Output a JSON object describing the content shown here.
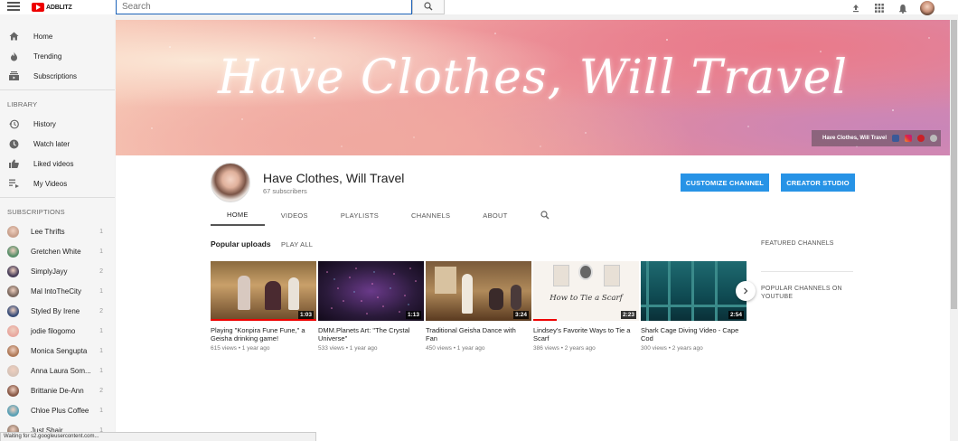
{
  "topbar": {
    "logo_text": "ADBLITZ",
    "search_placeholder": "Search"
  },
  "sidebar": {
    "main_items": [
      {
        "label": "Home",
        "icon": "home-icon"
      },
      {
        "label": "Trending",
        "icon": "flame-icon"
      },
      {
        "label": "Subscriptions",
        "icon": "subscriptions-icon"
      }
    ],
    "library_header": "LIBRARY",
    "library_items": [
      {
        "label": "History",
        "icon": "history-icon"
      },
      {
        "label": "Watch later",
        "icon": "clock-icon"
      },
      {
        "label": "Liked videos",
        "icon": "thumbs-up-icon"
      },
      {
        "label": "My Videos",
        "icon": "playlist-icon"
      }
    ],
    "subscriptions_header": "SUBSCRIPTIONS",
    "subscriptions": [
      {
        "name": "Lee Thrifts",
        "count": "1",
        "color": "#c9a18d"
      },
      {
        "name": "Gretchen White",
        "count": "1",
        "color": "#5a8f6a"
      },
      {
        "name": "SimplyJayy",
        "count": "2",
        "color": "#4a3f5a"
      },
      {
        "name": "Mal IntoTheCity",
        "count": "1",
        "color": "#7d6a60"
      },
      {
        "name": "Styled By Irene",
        "count": "2",
        "color": "#3b4f7a"
      },
      {
        "name": "jodie filogomo",
        "count": "1",
        "color": "#e8a9a0"
      },
      {
        "name": "Monica Sengupta",
        "count": "1",
        "color": "#b07b5a"
      },
      {
        "name": "Anna Laura Som...",
        "count": "1",
        "color": "#d8c4b8"
      },
      {
        "name": "Brittanie De-Ann",
        "count": "2",
        "color": "#8a5a48"
      },
      {
        "name": "Chloe Plus Coffee",
        "count": "1",
        "color": "#5aa0b5"
      },
      {
        "name": "Just Shair",
        "count": "1",
        "color": "#9a8070"
      }
    ]
  },
  "banner": {
    "title": "Have Clothes, Will Travel",
    "link_label": "Have Clothes, Will Travel"
  },
  "channel": {
    "name": "Have Clothes, Will Travel",
    "subscribers": "67 subscribers",
    "customize_label": "CUSTOMIZE CHANNEL",
    "studio_label": "CREATOR STUDIO",
    "tabs": [
      "HOME",
      "VIDEOS",
      "PLAYLISTS",
      "CHANNELS",
      "ABOUT"
    ]
  },
  "uploads": {
    "title": "Popular uploads",
    "play_all": "PLAY ALL",
    "videos": [
      {
        "title": "Playing \"Konpira Fune Fune,\" a Geisha drinking game!",
        "meta": "615 views • 1 year ago",
        "duration": "1:03",
        "progress": 1.0
      },
      {
        "title": "DMM.Planets Art: \"The Crystal Universe\"",
        "meta": "533 views • 1 year ago",
        "duration": "1:13",
        "progress": 0.0
      },
      {
        "title": "Traditional Geisha Dance with Fan",
        "meta": "450 views • 1 year ago",
        "duration": "3:24",
        "progress": 0.0
      },
      {
        "title": "Lindsey's Favorite Ways to Tie a Scarf",
        "meta": "386 views • 2 years ago",
        "duration": "2:23",
        "progress": 0.22
      },
      {
        "title": "Shark Cage Diving Video - Cape Cod",
        "meta": "300 views • 2 years ago",
        "duration": "2:54",
        "progress": 0.0
      }
    ],
    "scarf_thumb_text": "How to Tie a Scarf"
  },
  "right_panel": {
    "featured": "FEATURED CHANNELS",
    "popular": "POPULAR CHANNELS ON YOUTUBE"
  },
  "status_bar": "Waiting for s2.googleusercontent.com...",
  "colors": {
    "accent": "#2793e6",
    "youtube_red": "#e00000"
  }
}
